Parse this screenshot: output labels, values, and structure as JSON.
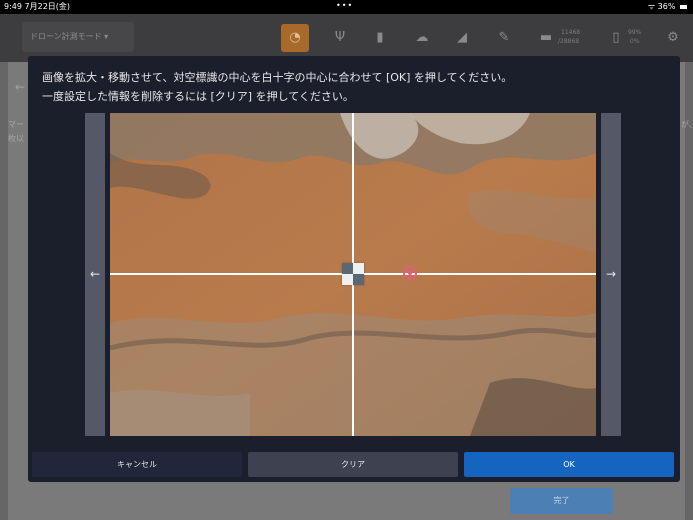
{
  "status_bar": {
    "time": "9:49",
    "date": "7月22日(金)",
    "dots": "•••",
    "battery": "36%"
  },
  "toolbar": {
    "mode_select_label": "ドローン計測モード",
    "storage_used": "11468",
    "storage_total": "/28868",
    "battery_text_1": "99%",
    "battery_text_2": "0%"
  },
  "background_page": {
    "left_text": "マー",
    "left_text_2": "枚以",
    "right_text": "が、",
    "complete_button": "完了"
  },
  "dialog": {
    "instruction_line1": "画像を拡大・移動させて、対空標識の中心を白十字の中心に合わせて [OK] を押してください。",
    "instruction_line2": "一度設定した情報を削除するには [クリア] を押してください。",
    "left_arrow": "←",
    "right_arrow": "→",
    "cancel_label": "キャンセル",
    "clear_label": "クリア",
    "ok_label": "OK"
  },
  "colors": {
    "modal_bg": "#1b1e2b",
    "ok_blue": "#1565c0",
    "target_pink": "#e85a86",
    "toolbar_accent": "#a86a2a"
  }
}
